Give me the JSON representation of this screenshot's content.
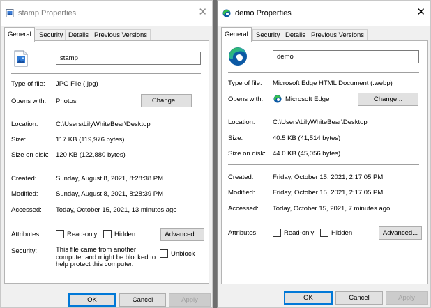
{
  "left": {
    "title": "stamp Properties",
    "tabs": [
      "General",
      "Security",
      "Details",
      "Previous Versions"
    ],
    "name_value": "stamp",
    "type_label": "Type of file:",
    "type_value": "JPG File (.jpg)",
    "opens_label": "Opens with:",
    "opens_value": "Photos",
    "change_label": "Change...",
    "location_label": "Location:",
    "location_value": "C:\\Users\\LilyWhiteBear\\Desktop",
    "size_label": "Size:",
    "size_value": "117 KB (119,976 bytes)",
    "disk_label": "Size on disk:",
    "disk_value": "120 KB (122,880 bytes)",
    "created_label": "Created:",
    "created_value": "Sunday, August 8, 2021, 8:28:38 PM",
    "modified_label": "Modified:",
    "modified_value": "Sunday, August 8, 2021, 8:28:39 PM",
    "accessed_label": "Accessed:",
    "accessed_value": "Today, October 15, 2021, 13 minutes ago",
    "attributes_label": "Attributes:",
    "readonly_label": "Read-only",
    "hidden_label": "Hidden",
    "advanced_label": "Advanced...",
    "security_label": "Security:",
    "security_line1": "This file came from another",
    "security_line2": "computer and might be blocked to",
    "security_line3": "help protect this computer.",
    "unblock_label": "Unblock",
    "ok_label": "OK",
    "cancel_label": "Cancel",
    "apply_label": "Apply"
  },
  "right": {
    "title": "demo Properties",
    "tabs": [
      "General",
      "Security",
      "Details",
      "Previous Versions"
    ],
    "name_value": "demo",
    "type_label": "Type of file:",
    "type_value": "Microsoft Edge HTML Document (.webp)",
    "opens_label": "Opens with:",
    "opens_value": "Microsoft Edge",
    "change_label": "Change...",
    "location_label": "Location:",
    "location_value": "C:\\Users\\LilyWhiteBear\\Desktop",
    "size_label": "Size:",
    "size_value": "40.5 KB (41,514 bytes)",
    "disk_label": "Size on disk:",
    "disk_value": "44.0 KB (45,056 bytes)",
    "created_label": "Created:",
    "created_value": "Friday, October 15, 2021, 2:17:05 PM",
    "modified_label": "Modified:",
    "modified_value": "Friday, October 15, 2021, 2:17:05 PM",
    "accessed_label": "Accessed:",
    "accessed_value": "Today, October 15, 2021, 7 minutes ago",
    "attributes_label": "Attributes:",
    "readonly_label": "Read-only",
    "hidden_label": "Hidden",
    "advanced_label": "Advanced...",
    "ok_label": "OK",
    "cancel_label": "Cancel",
    "apply_label": "Apply"
  },
  "icons": {
    "left_title": "image-file-icon",
    "left_file": "image-file-icon",
    "right_title": "edge-icon",
    "right_file": "edge-icon",
    "opens_with": "edge-icon",
    "close": "close-icon"
  },
  "colors": {
    "edge_blue": "#0c59a4",
    "edge_green": "#35c04e",
    "edge_teal": "#1ba1e2",
    "primary_border": "#0078d7"
  }
}
